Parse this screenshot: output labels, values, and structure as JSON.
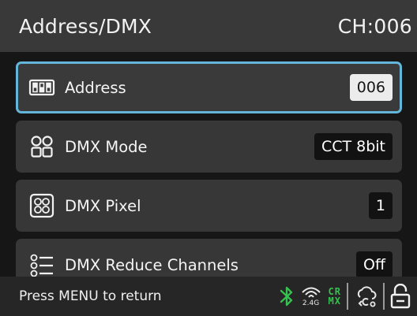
{
  "header": {
    "title": "Address/DMX",
    "channel": "CH:006"
  },
  "menu": {
    "items": [
      {
        "label": "Address",
        "value": "006",
        "icon": "dip-switch-icon",
        "selected": true
      },
      {
        "label": "DMX Mode",
        "value": "CCT 8bit",
        "icon": "dmx-mode-grid-icon",
        "selected": false
      },
      {
        "label": "DMX Pixel",
        "value": "1",
        "icon": "pixel-matrix-icon",
        "selected": false
      },
      {
        "label": "DMX Reduce Channels",
        "value": "Off",
        "icon": "reduce-channels-icon",
        "selected": false
      }
    ]
  },
  "footer": {
    "hint": "Press MENU to return",
    "band": "2.4G",
    "crmx_line1": "CR",
    "crmx_line2": "MX",
    "icons": [
      "bluetooth-icon",
      "wireless-2.4g-icon",
      "crmx-icon",
      "cloud-sync-icon",
      "unlock-icon"
    ]
  },
  "colors": {
    "header_bg": "#393939",
    "row_bg": "#373737",
    "selected_border": "#63b6da",
    "accent_green": "#35c24e",
    "background": "#161616"
  }
}
